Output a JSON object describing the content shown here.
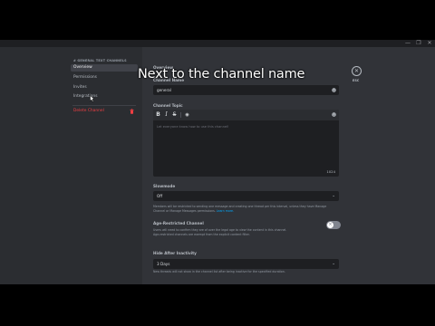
{
  "window": {
    "controls": [
      "—",
      "❐",
      "✕"
    ]
  },
  "sidebar": {
    "header": "# GENERAL  TEXT CHANNELS",
    "items": [
      {
        "label": "Overview",
        "active": true
      },
      {
        "label": "Permissions",
        "active": false
      },
      {
        "label": "Invites",
        "active": false
      },
      {
        "label": "Integrations",
        "active": false
      }
    ],
    "delete_label": "Delete Channel"
  },
  "main": {
    "overview_title": "Overview",
    "channel_name_label": "Channel Name",
    "channel_name_value": "general",
    "channel_topic_label": "Channel Topic",
    "topic_toolbar": {
      "bold": "B",
      "italic": "I",
      "strike": "S",
      "spoiler": "◉"
    },
    "topic_placeholder": "Let everyone know how to use this channel!",
    "topic_counter": "1024",
    "topic_help": "Members will be restricted to sending one message and creating one thread per this interval, unless they have Manage",
    "topic_help_line2": "Channel or Manage Messages permissions.",
    "topic_help_link": "Learn more.",
    "slowmode_label": "Slowmode",
    "slowmode_value": "Off",
    "age_label": "Age-Restricted Channel",
    "age_help": "Users will need to confirm they are of over the legal age to view the content in this channel.",
    "age_help_line2": "Age-restricted channels are exempt from the explicit content filter.",
    "hide_label": "Hide After Inactivity",
    "hide_value": "3 Days",
    "hide_help": "New threads will not show in the channel list after being inactive for the specified duration.",
    "close_label": "ESC"
  },
  "caption": "Next to the channel name",
  "colors": {
    "accent_link": "#00a8fc",
    "danger": "#f23f43"
  }
}
